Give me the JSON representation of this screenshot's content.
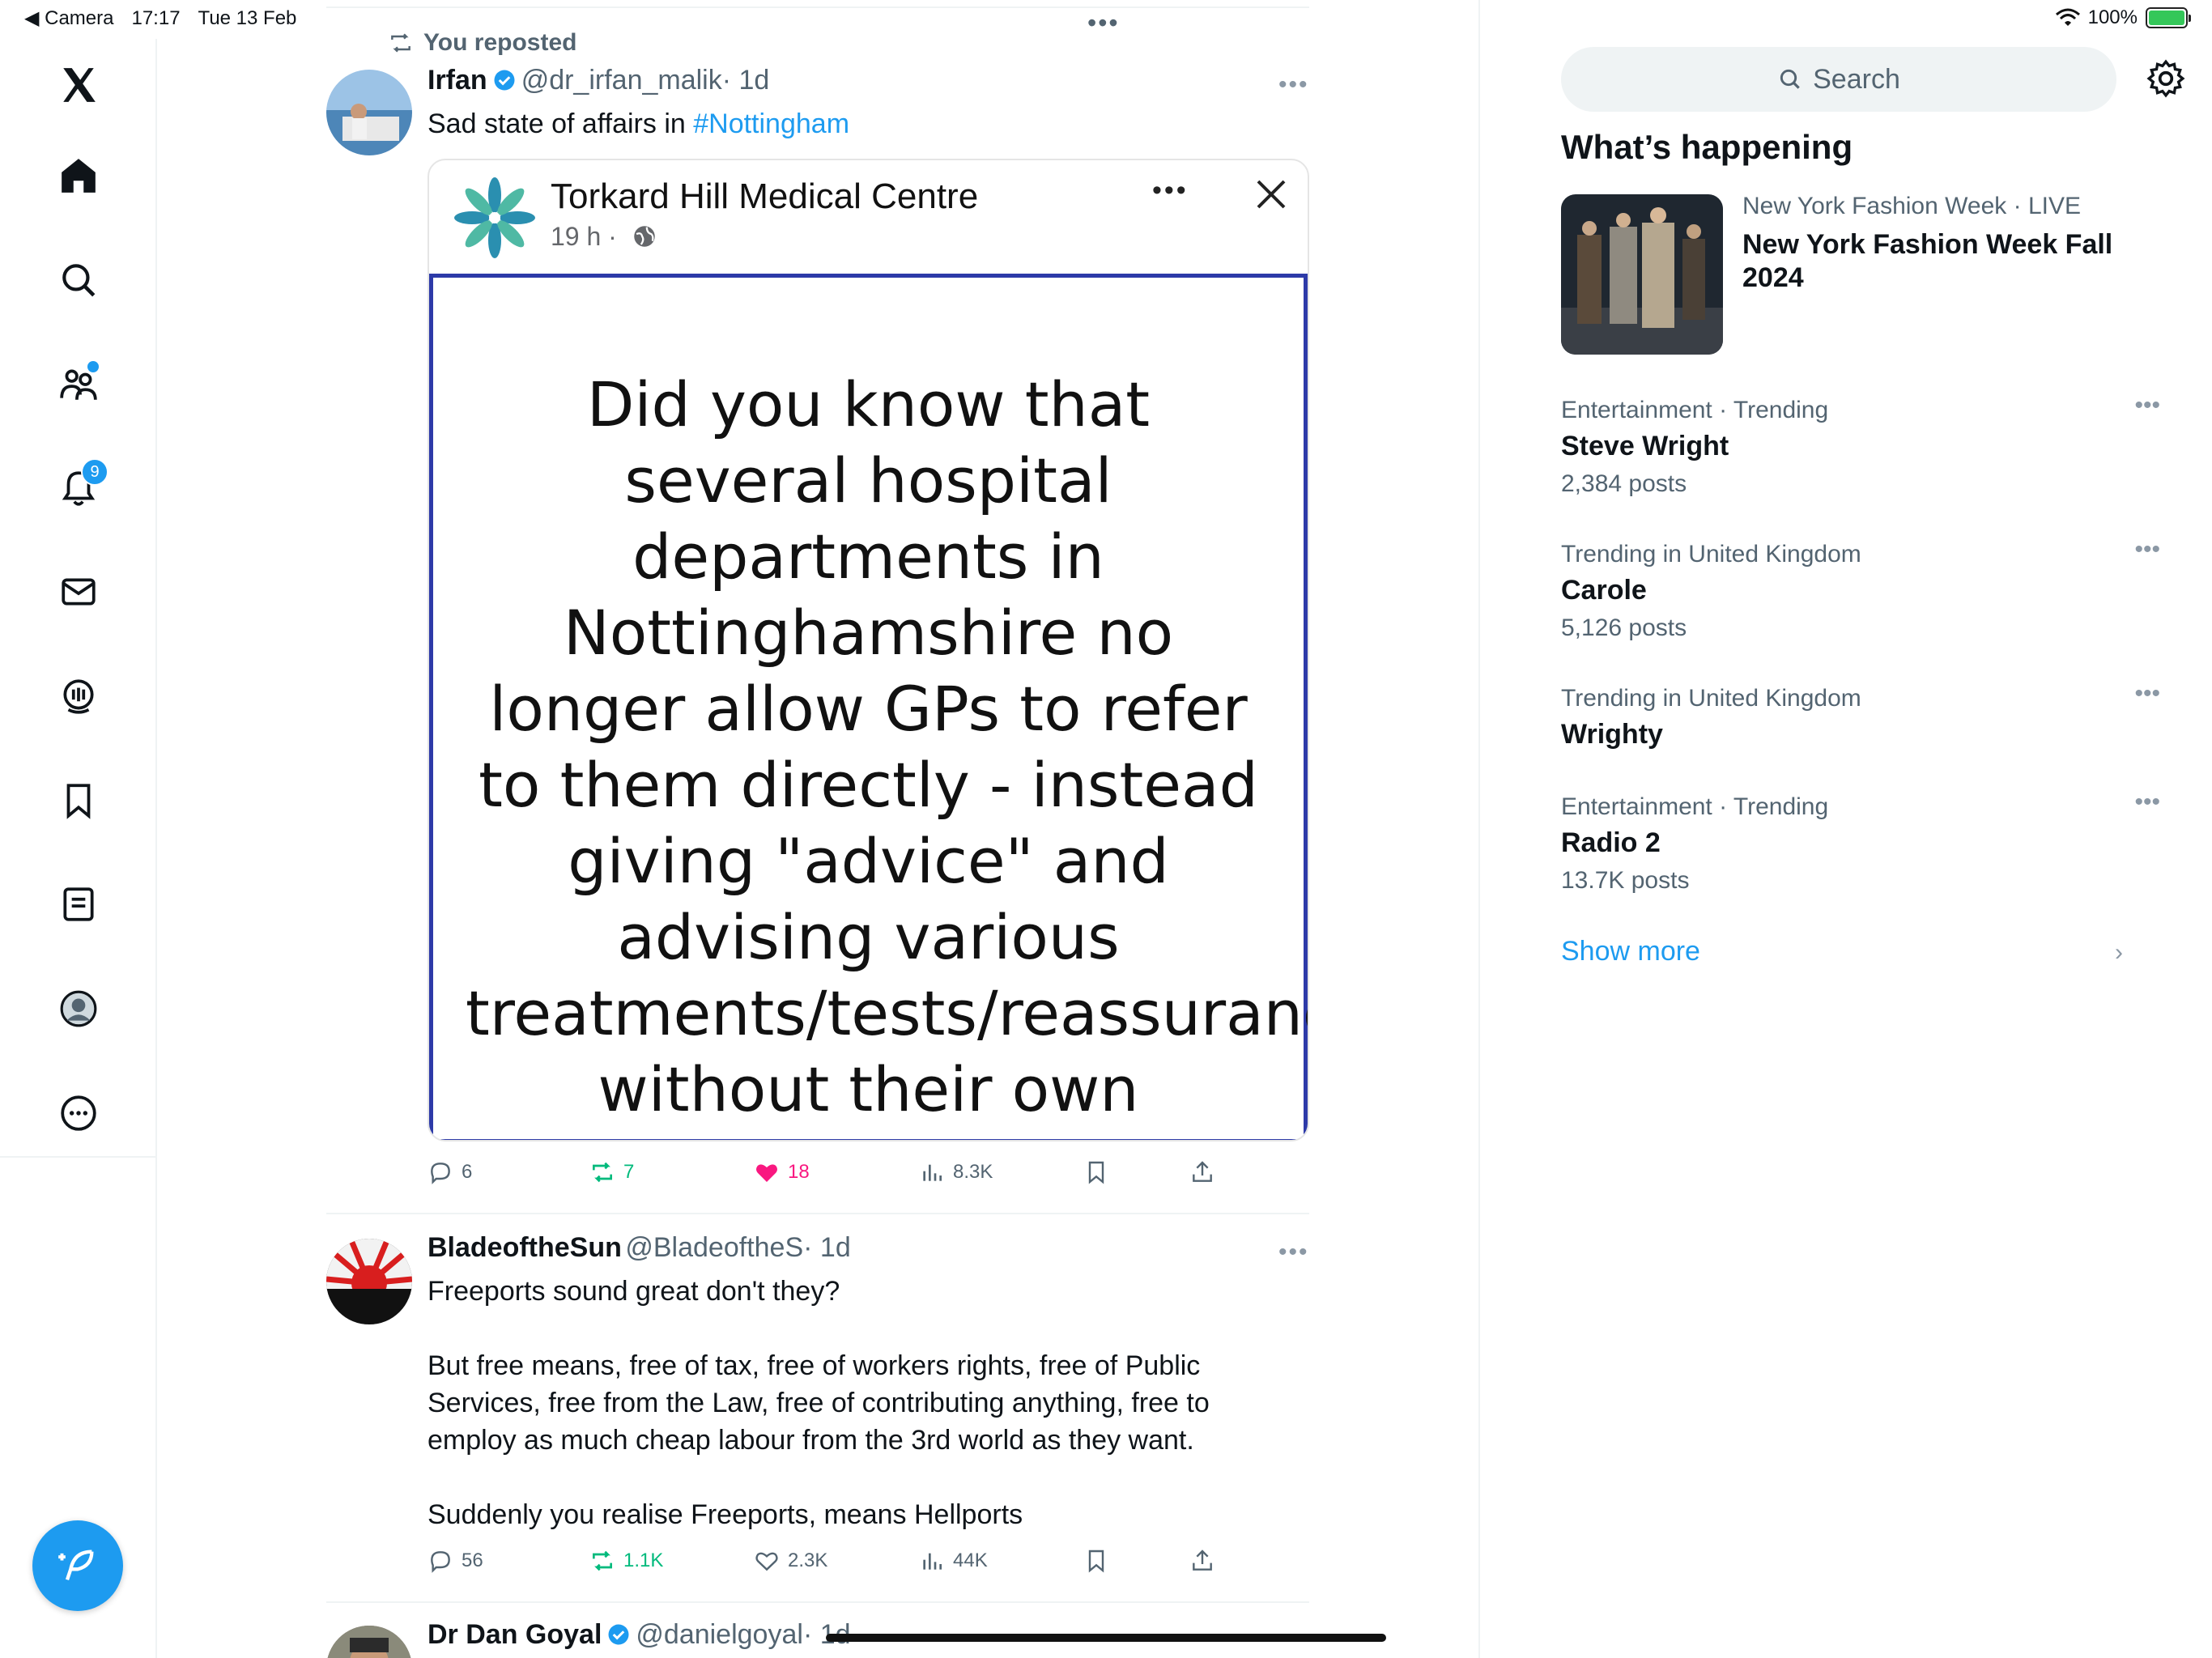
{
  "status_bar": {
    "back_app": "◀ Camera",
    "time": "17:17",
    "date": "Tue 13 Feb",
    "battery": "100%"
  },
  "nav": {
    "notifications_badge": "9",
    "icons": [
      "x-logo-icon",
      "home-icon",
      "search-icon",
      "communities-icon",
      "notifications-icon",
      "messages-icon",
      "spaces-icon",
      "bookmarks-icon",
      "lists-icon",
      "profile-icon",
      "more-icon"
    ],
    "accent": "#1d9bf0"
  },
  "feed": {
    "tweets": [
      {
        "repost_label": "You reposted",
        "name": "Irfan",
        "handle": "@dr_irfan_malik",
        "time": "· 1d",
        "text": "Sad state of affairs in ",
        "hashtag": "#Nottingham",
        "embed": {
          "title": "Torkard Hill Medical Centre",
          "meta": "19 h ·",
          "card_text": "Did you know that several hospital departments in Nottinghamshire no longer allow GPs to refer to them directly - instead giving \"advice\" and advising various treatments/tests/reassurance without their own assessments."
        },
        "stats": {
          "replies": "6",
          "reposts": "7",
          "likes": "18",
          "views": "8.3K"
        }
      },
      {
        "name": "BladeoftheSun",
        "handle": "@BladeoftheS",
        "time": "· 1d",
        "paragraphs": [
          "Freeports sound great don't they?",
          "But free means, free of tax, free of workers rights, free of Public Services, free from the Law, free of contributing anything, free to employ as much cheap labour from the 3rd world as they want.",
          "Suddenly you realise Freeports, means Hellports"
        ],
        "stats": {
          "replies": "56",
          "reposts": "1.1K",
          "likes": "2.3K",
          "views": "44K"
        }
      },
      {
        "name": "Dr Dan Goyal",
        "handle": "@danielgoyal",
        "time": "· 1d"
      }
    ]
  },
  "sidebar": {
    "search_placeholder": "Search",
    "section_title": "What’s happening",
    "news": {
      "category": "New York Fashion Week · LIVE",
      "title": "New York Fashion Week Fall 2024"
    },
    "trends": [
      {
        "meta": "Entertainment · Trending",
        "name": "Steve Wright",
        "count": "2,384 posts"
      },
      {
        "meta": "Trending in United Kingdom",
        "name": "Carole",
        "count": "5,126 posts"
      },
      {
        "meta": "Trending in United Kingdom",
        "name": "Wrighty",
        "count": ""
      },
      {
        "meta": "Entertainment · Trending",
        "name": "Radio 2",
        "count": "13.7K posts"
      }
    ],
    "show_more": "Show more"
  }
}
